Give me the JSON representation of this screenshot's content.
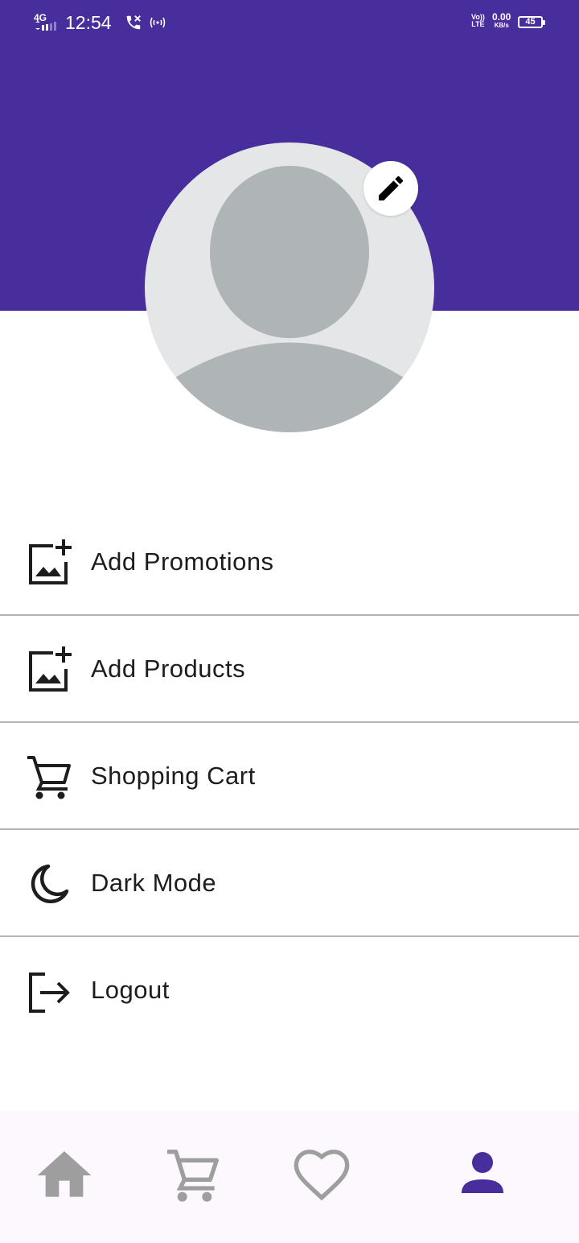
{
  "status_bar": {
    "network": "4G",
    "time": "12:54",
    "volte_top": "Vo))",
    "volte_bottom": "LTE",
    "speed_value": "0.00",
    "speed_unit": "KB/s",
    "battery": "45"
  },
  "profile": {
    "avatar_icon": "default-avatar",
    "edit_icon": "pencil-icon"
  },
  "menu": {
    "items": [
      {
        "label": "Add Promotions",
        "icon": "add-photo-icon"
      },
      {
        "label": "Add Products",
        "icon": "add-photo-icon"
      },
      {
        "label": "Shopping Cart",
        "icon": "cart-icon"
      },
      {
        "label": "Dark Mode",
        "icon": "moon-icon"
      },
      {
        "label": "Logout",
        "icon": "logout-icon"
      }
    ]
  },
  "bottom_nav": {
    "items": [
      {
        "icon": "home-icon",
        "active": false
      },
      {
        "icon": "cart-icon",
        "active": false
      },
      {
        "icon": "heart-icon",
        "active": false
      },
      {
        "icon": "person-icon",
        "active": true
      }
    ]
  },
  "colors": {
    "primary": "#482d9c",
    "inactive_nav": "#9e9e9e",
    "text": "#1d1d1d",
    "divider": "#b4b4b4",
    "avatar_bg": "#e4e6e7",
    "avatar_fg": "#afb4b7"
  }
}
